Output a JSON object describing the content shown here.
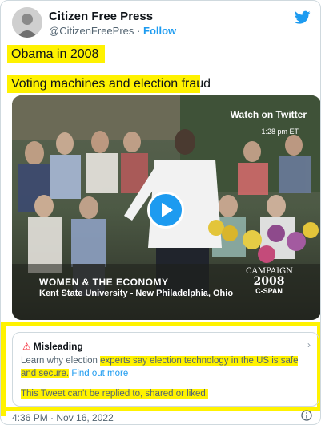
{
  "tweet": {
    "author_name": "Citizen Free Press",
    "author_handle": "@CitizenFreePres",
    "separator": "·",
    "follow_label": "Follow",
    "line1": "Obama in 2008",
    "line2": "Voting machines and election fraud",
    "timestamp": "4:36 PM · Nov 16, 2022"
  },
  "video": {
    "watch_label": "Watch on Twitter",
    "time_overlay": "1:28 pm ET",
    "caption_line1": "WOMEN & THE ECONOMY",
    "caption_line2": "Kent State University - New Philadelphia, Ohio",
    "badge_campaign": "CAMPAIGN",
    "badge_year": "2008",
    "badge_network": "C-SPAN"
  },
  "misleading": {
    "title": "Misleading",
    "text_part1": "Learn why election ",
    "text_part2": "experts say election technology in the US is safe and secure.",
    "link": "Find out more",
    "reply_note": "This Tweet can't be replied to, shared or liked."
  },
  "colors": {
    "highlight": "#fff200",
    "accent": "#1d9bf0",
    "warning": "#f4212e"
  }
}
